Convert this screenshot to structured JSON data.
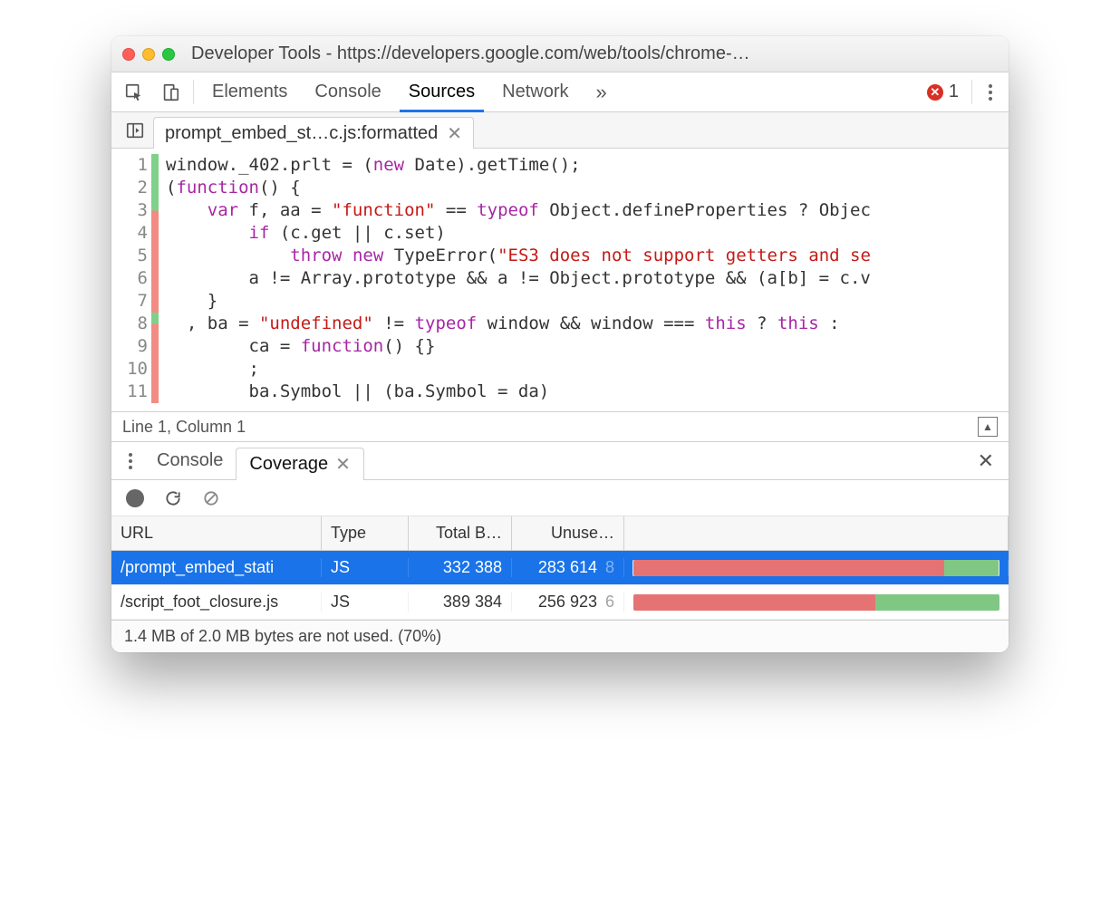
{
  "window": {
    "title": "Developer Tools - https://developers.google.com/web/tools/chrome-…"
  },
  "toolbar": {
    "tabs": {
      "elements": "Elements",
      "console": "Console",
      "sources": "Sources",
      "network": "Network"
    },
    "overflow_glyph": "»",
    "error_count": "1"
  },
  "file_tab": {
    "label": "prompt_embed_st…c.js:formatted"
  },
  "code": {
    "lines": [
      {
        "n": "1",
        "cov": "g",
        "html": "window._402.prlt = (<span class='tk-kw'>new</span> Date).getTime();"
      },
      {
        "n": "2",
        "cov": "g",
        "html": "(<span class='tk-kw'>function</span>() {"
      },
      {
        "n": "3",
        "cov": "split",
        "html": "    <span class='tk-kw'>var</span> f, aa = <span class='tk-str'>\"function\"</span> == <span class='tk-kw'>typeof</span> Object.defineProperties ? Objec"
      },
      {
        "n": "4",
        "cov": "r",
        "html": "        <span class='tk-kw'>if</span> (c.get || c.set)"
      },
      {
        "n": "5",
        "cov": "r",
        "html": "            <span class='tk-kw'>throw</span> <span class='tk-kw'>new</span> TypeError(<span class='tk-str'>\"ES3 does not support getters and se</span>"
      },
      {
        "n": "6",
        "cov": "r",
        "html": "        a != Array.prototype && a != Object.prototype && (a[b] = c.v"
      },
      {
        "n": "7",
        "cov": "r",
        "html": "    }"
      },
      {
        "n": "8",
        "cov": "split",
        "html": "  , ba = <span class='tk-str'>\"undefined\"</span> != <span class='tk-kw'>typeof</span> window && window === <span class='tk-this'>this</span> ? <span class='tk-this'>this</span> : "
      },
      {
        "n": "9",
        "cov": "r",
        "html": "        ca = <span class='tk-kw'>function</span>() {}"
      },
      {
        "n": "10",
        "cov": "r",
        "html": "        ;"
      },
      {
        "n": "11",
        "cov": "r",
        "html": "        ba.Symbol || (ba.Symbol = da)"
      }
    ]
  },
  "status_line": "Line 1, Column 1",
  "drawer": {
    "tabs": {
      "console": "Console",
      "coverage": "Coverage"
    }
  },
  "coverage": {
    "headers": {
      "url": "URL",
      "type": "Type",
      "total": "Total B…",
      "unused": "Unuse…"
    },
    "rows": [
      {
        "url": "/prompt_embed_stati",
        "type": "JS",
        "total": "332 388",
        "unused": "283 614",
        "unused_trail": "8",
        "unused_pct": 85,
        "selected": true
      },
      {
        "url": "/script_foot_closure.js",
        "type": "JS",
        "total": "389 384",
        "unused": "256 923",
        "unused_trail": "6",
        "unused_pct": 66,
        "selected": false
      }
    ],
    "footer": "1.4 MB of 2.0 MB bytes are not used. (70%)"
  }
}
